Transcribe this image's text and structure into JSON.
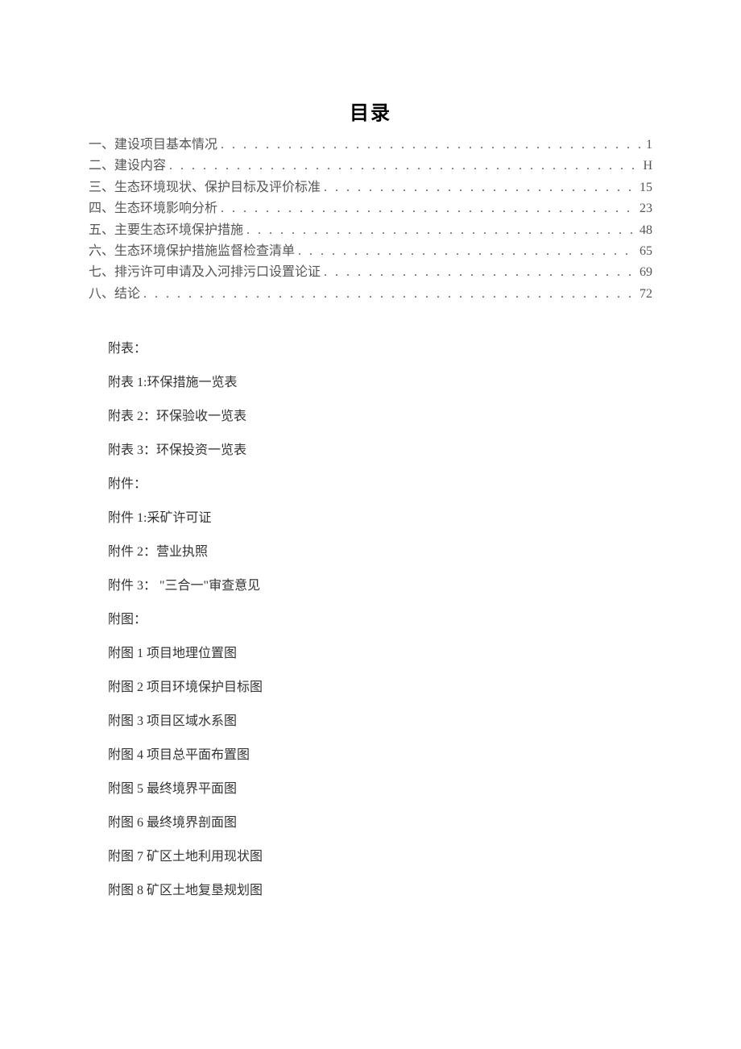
{
  "title": "目录",
  "toc": [
    {
      "label": "一、建设项目基本情况",
      "page": "1"
    },
    {
      "label": "二、建设内容",
      "page": "H"
    },
    {
      "label": "三、生态环境现状、保护目标及评价标准",
      "page": "15"
    },
    {
      "label": "四、生态环境影响分析",
      "page": "23"
    },
    {
      "label": "五、主要生态环境保护措施",
      "page": "48"
    },
    {
      "label": "六、生态环境保护措施监督检查清单",
      "page": "65"
    },
    {
      "label": "七、排污许可申请及入河排污口设置论证",
      "page": "69"
    },
    {
      "label": "八、结论",
      "page": "72"
    }
  ],
  "appendix": {
    "tables": {
      "header": "附表：",
      "items": [
        "附表 1:环保措施一览表",
        "附表 2：环保验收一览表",
        "附表 3：环保投资一览表"
      ]
    },
    "attachments": {
      "header": "附件：",
      "items": [
        "附件 1:采矿许可证",
        "附件 2：营业执照",
        "附件 3： \"三合一\"审查意见"
      ]
    },
    "figures": {
      "header": "附图：",
      "items": [
        "附图 1 项目地理位置图",
        "附图 2 项目环境保护目标图",
        "附图 3 项目区域水系图",
        "附图 4 项目总平面布置图",
        "附图 5 最终境界平面图",
        "附图 6 最终境界剖面图",
        "附图 7 矿区土地利用现状图",
        "附图 8 矿区土地复垦规划图"
      ]
    }
  },
  "dots": ". . . . . . . . . . . . . . . . . . . . . . . . . . . . . . . . . . . . . . . . . . . . . . . . . . . . . . . . . . . . . . . . . . . . . . . . . . . . . . . ."
}
